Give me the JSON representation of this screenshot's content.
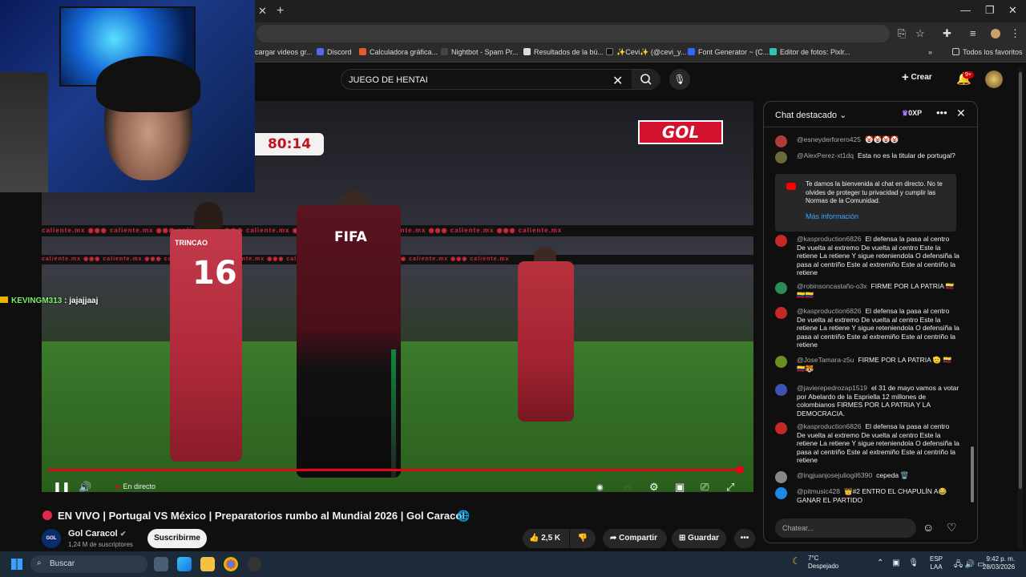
{
  "browser": {
    "bookmarks": [
      {
        "label": "cargar videos gr...",
        "color": "#ffffff"
      },
      {
        "label": "Discord",
        "color": "#5865f2"
      },
      {
        "label": "Calculadora gráfica...",
        "color": "#e35b2b"
      },
      {
        "label": "Nightbot - Spam Pr...",
        "color": "#444444"
      },
      {
        "label": "Resultados de la bú...",
        "color": "#dddddd"
      },
      {
        "label": "✨Cevi✨ (@cevi_y...",
        "color": "#111111"
      },
      {
        "label": "Font Generator ~ (C...",
        "color": "#3366ff"
      },
      {
        "label": "Editor de fotos: Pixlr...",
        "color": "#2ec4b6"
      }
    ],
    "all_bookmarks": "Todos los favoritos"
  },
  "masthead": {
    "search_query": "JUEGO DE HENTAI",
    "create_label": "Crear",
    "notifications": "9+"
  },
  "video": {
    "scoreboard_time": "80:14",
    "broadcaster_logo": "GOL",
    "ad_text": "caliente.mx  ◉◉◉  caliente.mx  ◉◉◉  caliente.mx  ◉◉◉  caliente.mx  ◉◉◉  caliente.mx  ◉◉◉  caliente.mx  ◉◉◉  caliente.mx  ◉◉◉  caliente.mx",
    "player16_name": "TRINCAO",
    "player16_number": "16",
    "ref_text": "FIFA",
    "live_label": "En directo",
    "progress": 0.99
  },
  "overlay_chat": {
    "user": "KEVINGM313",
    "text": ": jajajjaaj"
  },
  "watch": {
    "title": "EN VIVO | Portugal VS México | Preparatorios rumbo al Mundial 2026 | Gol Caracol",
    "channel_avatar": "GOL",
    "channel": "Gol Caracol",
    "subscribers": "1,24 M de suscriptores",
    "subscribe": "Suscribirme",
    "likes": "2,5 K",
    "share": "Compartir",
    "save": "Guardar"
  },
  "chat": {
    "title": "Chat destacado",
    "xp": "0XP",
    "messages": [
      {
        "author": "@esneyderforero425",
        "text": "🤡🤡🤡🤡",
        "color": "#b23a3a"
      },
      {
        "author": "@AlexPerez-xt1dq",
        "text": "Esta no es la titular de portugal?",
        "color": "#6b6b3a"
      },
      {
        "author": "@kasproduction6826",
        "text": "El defensa la pasa al centro De vuelta al extremo De vuelta al centro Este la retiene La retiene Y sigue reteniendola O defensiña la pasa al centriño Este al extremiño Este al centriño la retiene",
        "color": "#c62828"
      },
      {
        "author": "@robinsoncastaño-o3x",
        "text": "FIRME POR LA PATRIA 🇨🇴🇨🇴🇨🇴",
        "color": "#2e8b57"
      },
      {
        "author": "@kasproduction6826",
        "text": "El defensa la pasa al centro De vuelta al extremo De vuelta al centro Este la retiene La retiene Y sigue reteniendola O defensiña la pasa al centriño Este al extremiño Este al centriño la retiene",
        "color": "#c62828"
      },
      {
        "author": "@JoseTamara-z5u",
        "text": "FIRME POR LA PATRIA 🫡 🇨🇴🇨🇴🐯",
        "color": "#6b8e23"
      },
      {
        "author": "@javierepedrozap1519",
        "text": "el 31 de mayo vamos a votar por Abelardo de la Espriella 12 millones de colombianos FIRMES POR LA PATRIA Y LA DEMOCRACIA.",
        "color": "#3f51b5"
      },
      {
        "author": "@kasproduction6826",
        "text": "El defensa la pasa al centro De vuelta al extremo De vuelta al centro Este la retiene La retiene Y sigue reteniendola O defensiña la pasa al centriño Este al extremiño Este al centriño la retiene",
        "color": "#c62828"
      },
      {
        "author": "@ingjuanjosejuliogil6390",
        "text": "cepeda 🗑️",
        "color": "#888888"
      },
      {
        "author": "@pitmusic428",
        "text": "👑#2  ENTRO EL CHAPULÍN A😂 GANAR EL PARTIDO",
        "color": "#1e88e5"
      }
    ],
    "welcome_text": "Te damos la bienvenida al chat en directo. No te olvides de proteger tu privacidad y cumplir las Normas de la Comunidad.",
    "welcome_link": "Más información",
    "input_placeholder": "Chatear..."
  },
  "taskbar": {
    "search_placeholder": "Buscar",
    "temperature": "7°C",
    "weather": "Despejado",
    "lang1": "ESP",
    "lang2": "LAA",
    "time": "9:42 p. m.",
    "date": "28/03/2026"
  }
}
